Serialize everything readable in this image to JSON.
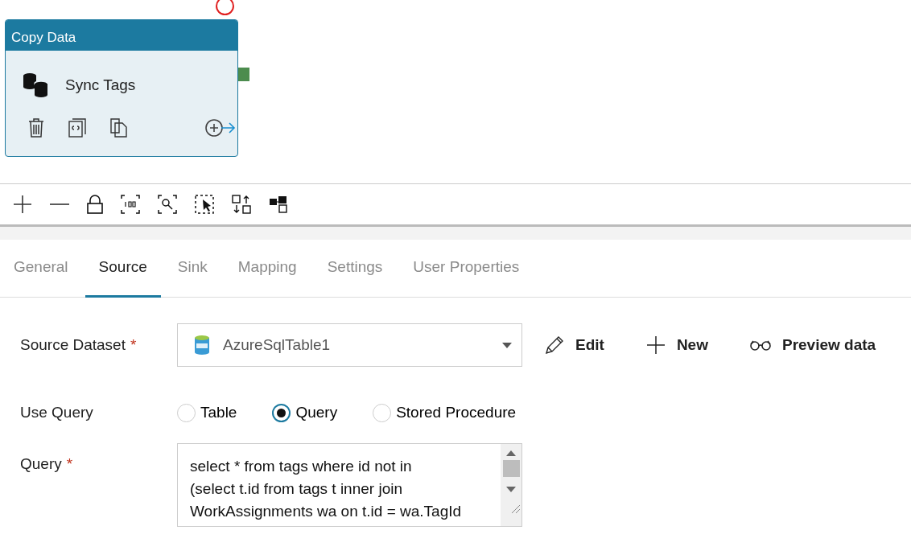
{
  "activity": {
    "type_label": "Copy Data",
    "name": "Sync Tags"
  },
  "tabs": [
    {
      "label": "General",
      "selected": false
    },
    {
      "label": "Source",
      "selected": true
    },
    {
      "label": "Sink",
      "selected": false
    },
    {
      "label": "Mapping",
      "selected": false
    },
    {
      "label": "Settings",
      "selected": false
    },
    {
      "label": "User Properties",
      "selected": false
    }
  ],
  "source_dataset": {
    "label": "Source Dataset",
    "required_mark": "*",
    "value": "AzureSqlTable1"
  },
  "actions": [
    {
      "kind": "edit",
      "label": "Edit"
    },
    {
      "kind": "new",
      "label": "New"
    },
    {
      "kind": "preview",
      "label": "Preview data"
    }
  ],
  "use_query": {
    "label": "Use Query",
    "options": [
      {
        "label": "Table",
        "selected": false
      },
      {
        "label": "Query",
        "selected": true
      },
      {
        "label": "Stored Procedure",
        "selected": false
      }
    ]
  },
  "query": {
    "label": "Query",
    "required_mark": "*",
    "lines": [
      "select * from tags where id not in",
      "(select t.id from tags t inner join",
      "WorkAssignments wa on t.id = wa.TagId"
    ]
  }
}
